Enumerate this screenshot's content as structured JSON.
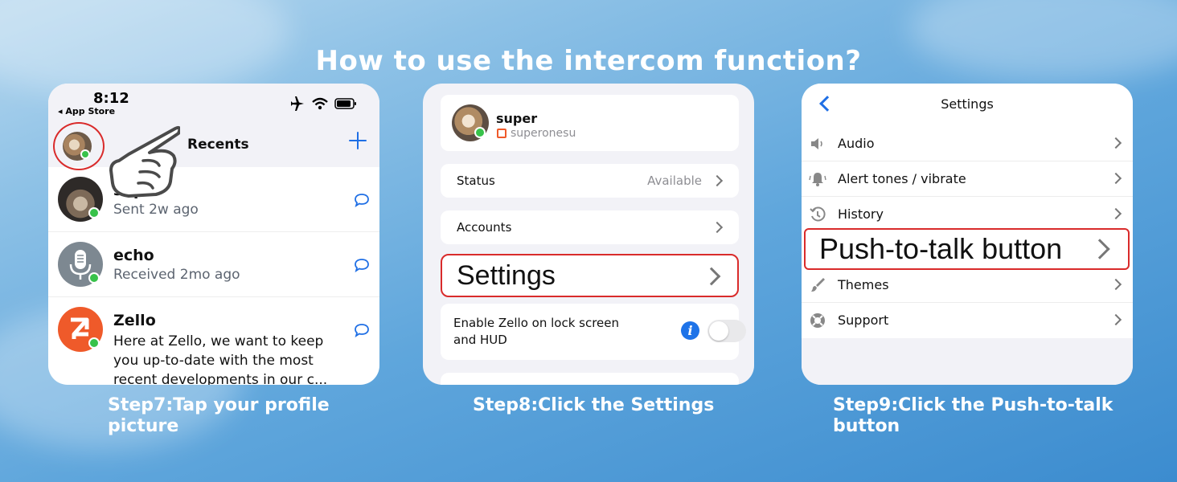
{
  "headline": "How to use the intercom function?",
  "colors": {
    "accent_blue": "#1f6fe5",
    "highlight_red": "#d92b2b",
    "online_green": "#38c24a",
    "zello_orange": "#ef5a2a"
  },
  "phone1": {
    "time": "8:12",
    "back_app": "◂ App Store",
    "title": "Recents",
    "contacts": [
      {
        "name": "super",
        "sub": "Sent 2w ago"
      },
      {
        "name": "echo",
        "sub": "Received 2mo ago"
      },
      {
        "name": "Zello",
        "text": "Here at Zello, we want to keep you up-to-date with the most recent developments in our c..."
      }
    ]
  },
  "phone2": {
    "profile_name": "super",
    "profile_handle": "superonesu",
    "status_label": "Status",
    "status_value": "Available",
    "accounts_label": "Accounts",
    "settings_label": "Settings",
    "lock_screen_label": "Enable Zello on lock screen and HUD",
    "info_glyph": "i"
  },
  "phone3": {
    "title": "Settings",
    "items": [
      "Audio",
      "Alert tones / vibrate",
      "History",
      "Push-to-talk button",
      "Themes",
      "Support"
    ]
  },
  "captions": {
    "step7": "Step7:Tap your profile picture",
    "step8": "Step8:Click the Settings",
    "step9": "Step9:Click the Push-to-talk button"
  }
}
